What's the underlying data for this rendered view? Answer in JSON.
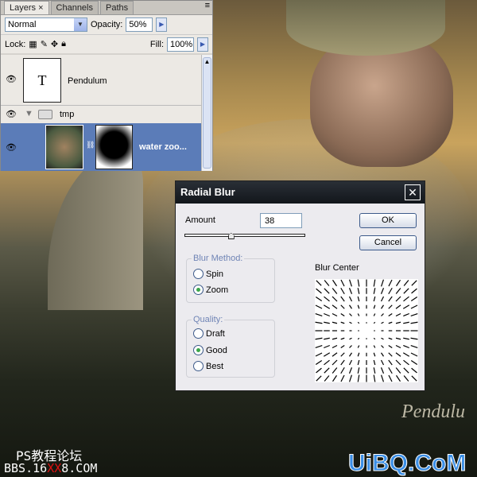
{
  "layers_panel": {
    "tabs": [
      "Layers",
      "Channels",
      "Paths"
    ],
    "blend_mode": "Normal",
    "opacity_label": "Opacity:",
    "opacity": "50%",
    "lock_label": "Lock:",
    "fill_label": "Fill:",
    "fill": "100%",
    "layers": [
      {
        "name": "Pendulum",
        "thumb": "T"
      },
      {
        "name": "tmp"
      },
      {
        "name": "water zoo..."
      }
    ]
  },
  "dialog": {
    "title": "Radial Blur",
    "amount_label": "Amount",
    "amount": "38",
    "amount_slider_fraction": 0.38,
    "ok": "OK",
    "cancel": "Cancel",
    "blur_method_label": "Blur Method:",
    "methods": [
      "Spin",
      "Zoom"
    ],
    "selected_method": "Zoom",
    "quality_label": "Quality:",
    "qualities": [
      "Draft",
      "Good",
      "Best"
    ],
    "selected_quality": "Good",
    "blur_center_label": "Blur Center"
  },
  "watermarks": {
    "forum": "PS教程论坛",
    "bbs_a": "BBS.16",
    "bbs_b": "XX",
    "bbs_c": "8.COM",
    "uibq": "UiBQ.CoM",
    "signature": "Pendulu"
  }
}
